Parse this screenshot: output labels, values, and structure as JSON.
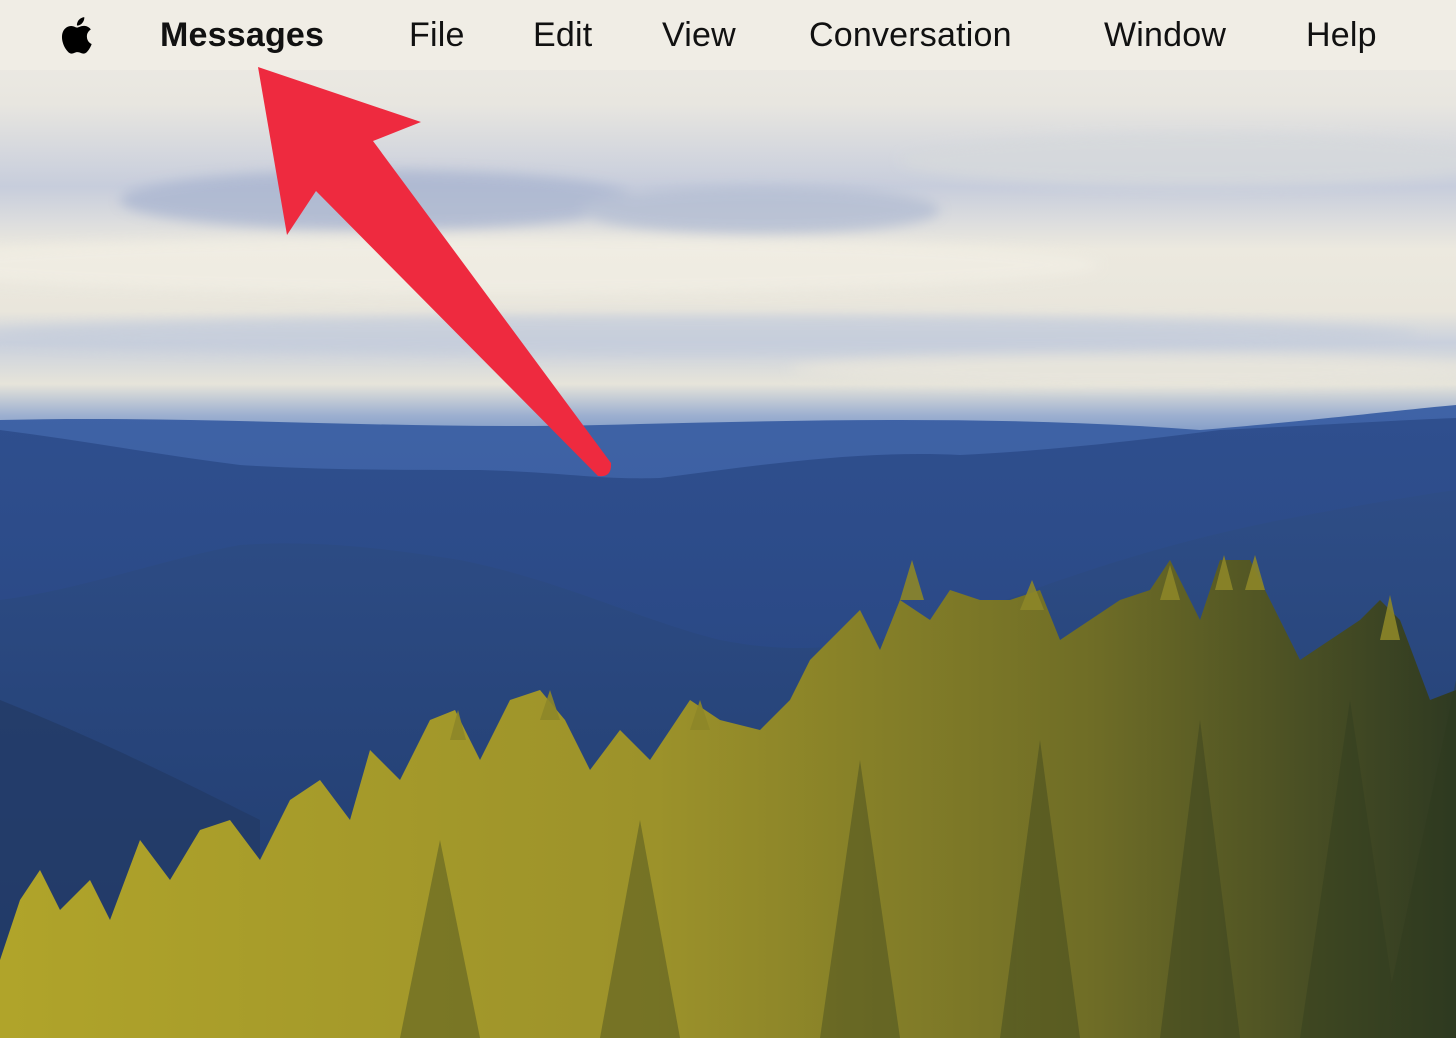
{
  "menubar": {
    "apple_icon": "apple-logo-icon",
    "app_name": "Messages",
    "items": [
      {
        "label": "File"
      },
      {
        "label": "Edit"
      },
      {
        "label": "View"
      },
      {
        "label": "Conversation"
      },
      {
        "label": "Window"
      },
      {
        "label": "Help"
      }
    ]
  },
  "annotation": {
    "type": "arrow",
    "points_to": "Messages",
    "color": "#ee2a3f"
  },
  "wallpaper": {
    "description": "Forested mountain landscape under cloudy sky",
    "colors": {
      "sky_light": "#efece2",
      "cloud_blue": "#9aaed0",
      "haze_blue": "#4b72b0",
      "mountain_dark": "#2c4a86",
      "tree_gold": "#a49a28",
      "tree_dark": "#3a4a22"
    }
  }
}
